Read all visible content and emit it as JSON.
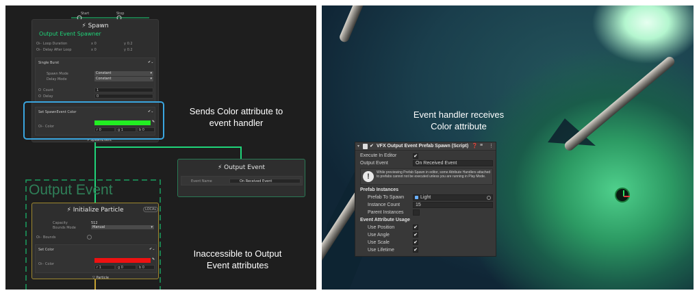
{
  "left_graph": {
    "spawn_node": {
      "port_start": "Start",
      "port_stop": "Stop",
      "title": "Spawn",
      "subtitle": "Output Event Spawner",
      "rows": [
        {
          "label": "Loop Duration",
          "x": "0",
          "y": "0.2"
        },
        {
          "label": "Delay After Loop",
          "x": "0",
          "y": "0.2"
        }
      ],
      "single_burst": {
        "title": "Single Burst",
        "spawn_mode_label": "Spawn Mode",
        "spawn_mode_value": "Constant",
        "delay_mode_label": "Delay Mode",
        "delay_mode_value": "Constant",
        "count_label": "Count",
        "count_value": "1",
        "delay_label": "Delay",
        "delay_value": "0"
      },
      "set_color": {
        "title": "Set SpawnEvent Color",
        "color_label": "Color",
        "r": "0",
        "g": "1",
        "b": "0",
        "color_hex": "#22ee22"
      },
      "output_port": "SpawnEvent"
    },
    "output_event_node": {
      "title": "Output Event",
      "field_label": "Event Name",
      "field_value": "On Received Event"
    },
    "output_event_group_title": "Output Event",
    "init_node": {
      "title": "Initialize Particle",
      "badge": "LOCAL",
      "capacity_label": "Capacity",
      "capacity_value": "512",
      "bounds_mode_label": "Bounds Mode",
      "bounds_mode_value": "Manual",
      "bounds_label": "Bounds",
      "set_color": {
        "title": "Set Color",
        "color_label": "Color",
        "r": "1",
        "g": "0",
        "b": "0",
        "color_hex": "#ee1111"
      },
      "output_port": "Particle"
    },
    "caption_top": [
      "Sends Color attribute to",
      "event handler"
    ],
    "caption_bottom": [
      "Inaccessible to Output",
      "Event attributes"
    ]
  },
  "right_view": {
    "caption": [
      "Event handler receives",
      "Color attribute"
    ],
    "inspector": {
      "title": "VFX Output Event Prefab Spawn (Script)",
      "execute_in_editor_label": "Execute In Editor",
      "output_event_label": "Output Event",
      "output_event_value": "On Received Event",
      "warning_text": "While previewing Prefab Spawn in editor, some Attribute Handlers attached to prefabs cannot not be executed unless you are running in Play Mode.",
      "prefab_instances_header": "Prefab Instances",
      "prefab_to_spawn_label": "Prefab To Spawn",
      "prefab_to_spawn_value": "Light",
      "instance_count_label": "Instance Count",
      "instance_count_value": "15",
      "parent_instances_label": "Parent Instances",
      "event_usage_header": "Event Attribute Usage",
      "use_position_label": "Use Position",
      "use_angle_label": "Use Angle",
      "use_scale_label": "Use Scale",
      "use_lifetime_label": "Use Lifetime",
      "check": "✔"
    }
  },
  "colors": {
    "accent_green": "#1fd67a",
    "highlight_blue": "#3aa6e0",
    "particle_yellow": "#c7a232"
  }
}
